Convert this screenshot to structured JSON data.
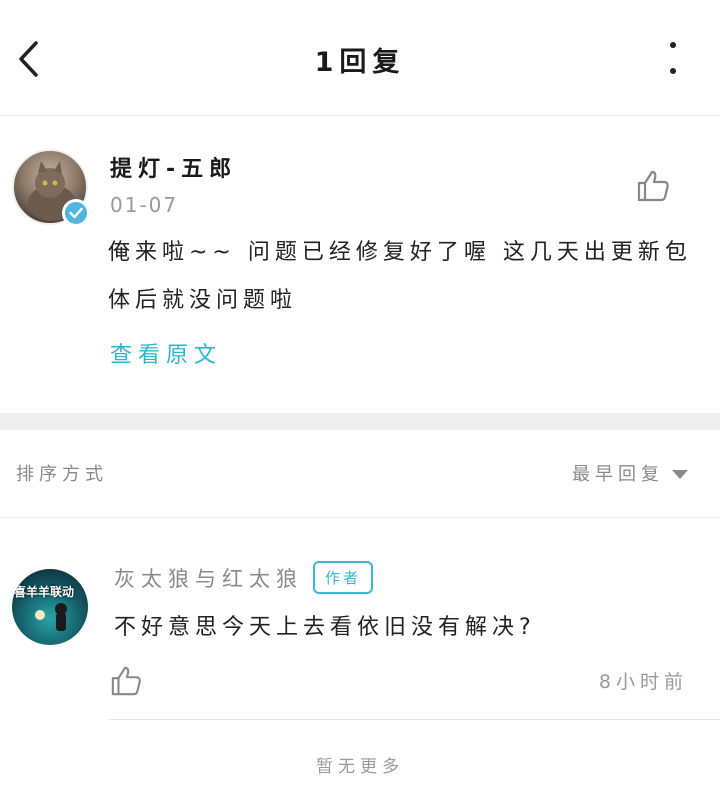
{
  "header": {
    "title": "1回复",
    "back_icon": "chevron-left-icon",
    "more_icon": "more-vertical-icon"
  },
  "post": {
    "author": "提灯-五郎",
    "date": "01-07",
    "body": "俺来啦~~ 问题已经修复好了喔  这几天出更新包体后就没问题啦",
    "view_original": "查看原文",
    "verified_icon": "verified-check-icon",
    "like_icon": "thumbs-up-icon"
  },
  "sort": {
    "label": "排序方式",
    "selected": "最早回复"
  },
  "replies": [
    {
      "author": "灰太狼与红太狼",
      "badge": "作者",
      "avatar_text": "喜羊羊联动",
      "body": "不好意思今天上去看依旧没有解决?",
      "time": "8小时前",
      "like_icon": "thumbs-up-icon"
    }
  ],
  "footer": {
    "no_more": "暂无更多"
  },
  "colors": {
    "accent": "#2fb4cf",
    "verified": "#4fb6e0",
    "muted_text": "#8a8a8a",
    "divider": "#eeeeee"
  }
}
